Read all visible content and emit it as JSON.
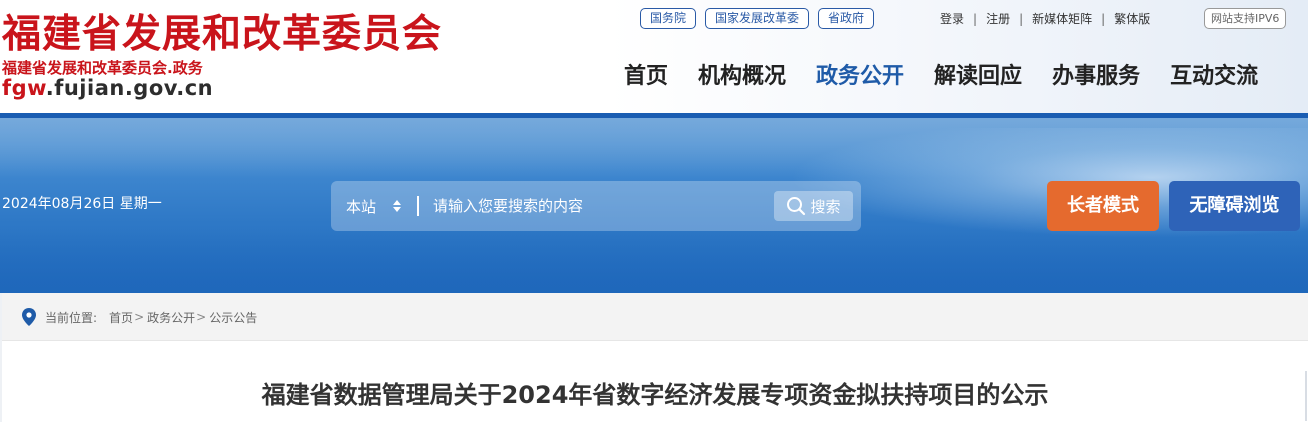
{
  "site": {
    "title": "福建省发展和改革委员会",
    "subtitle": "福建省发展和改革委员会.政务",
    "domain_prefix": "fgw",
    "domain_suffix": ".fujian.gov.cn"
  },
  "top_links": [
    "国务院",
    "国家发展改革委",
    "省政府"
  ],
  "user_links": [
    "登录",
    "注册",
    "新媒体矩阵",
    "繁体版"
  ],
  "ipv6_label": "网站支持IPV6",
  "nav": [
    {
      "label": "首页",
      "active": false
    },
    {
      "label": "机构概况",
      "active": false
    },
    {
      "label": "政务公开",
      "active": true
    },
    {
      "label": "解读回应",
      "active": false
    },
    {
      "label": "办事服务",
      "active": false
    },
    {
      "label": "互动交流",
      "active": false
    }
  ],
  "date_text": "2024年08月26日 星期一",
  "search": {
    "scope": "本站",
    "placeholder": "请输入您要搜索的内容",
    "button_label": "搜索"
  },
  "elder_mode_label": "长者模式",
  "accessible_label": "无障碍浏览",
  "breadcrumb": {
    "label": "当前位置:",
    "items": [
      "首页",
      "政务公开",
      "公示公告"
    ]
  },
  "article": {
    "title": "福建省数据管理局关于2024年省数字经济发展专项资金拟扶持项目的公示"
  },
  "colors": {
    "brand_red": "#c9141b",
    "brand_blue": "#1a5db2",
    "nav_active": "#1f5ba8",
    "elder_orange": "#e56a2e",
    "access_blue": "#2e63b8"
  }
}
